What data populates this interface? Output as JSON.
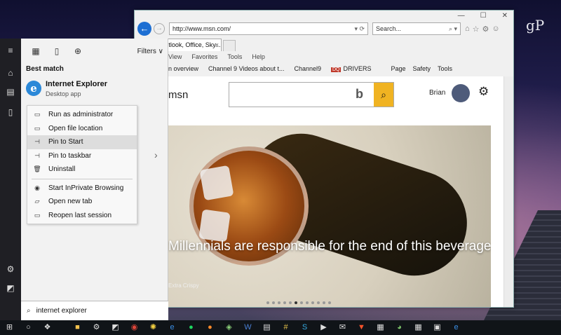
{
  "desktop": {
    "watermark": "gP"
  },
  "start_rail": {
    "icons": [
      "hamburger-icon",
      "home-icon",
      "documents-icon",
      "device-icon",
      "settings-icon",
      "windows-store-icon"
    ]
  },
  "start_panel": {
    "filters_label": "Filters",
    "best_match_heading": "Best match",
    "best_match_title": "Internet Explorer",
    "best_match_subtitle": "Desktop app",
    "context_menu": [
      {
        "label": "Run as administrator",
        "icon": "run-as-admin-icon"
      },
      {
        "label": "Open file location",
        "icon": "open-file-location-icon"
      },
      {
        "label": "Pin to Start",
        "icon": "pin-icon",
        "highlighted": true
      },
      {
        "label": "Pin to taskbar",
        "icon": "pin-icon"
      },
      {
        "label": "Uninstall",
        "icon": "trash-icon"
      },
      {
        "label": "Start InPrivate Browsing",
        "icon": "inprivate-icon",
        "separator_before": true
      },
      {
        "label": "Open new tab",
        "icon": "new-tab-icon"
      },
      {
        "label": "Reopen last session",
        "icon": "reopen-icon"
      }
    ],
    "search_text": "internet explorer"
  },
  "ie_window": {
    "url": "http://www.msn.com/",
    "search_placeholder": "Search...",
    "tab_title": "MSN | Outlook, Office, Sky...",
    "menu": [
      "View",
      "Favorites",
      "Tools",
      "Help"
    ],
    "favorites": [
      "n overview",
      "Channel 9 Videos about t...",
      "Channel9",
      "DRIVERS"
    ],
    "commands": [
      "Page",
      "Safety",
      "Tools"
    ],
    "msn": {
      "logo": "msn",
      "user_name": "Brian",
      "headline": "Millennials are responsible for the end of this beverage",
      "source": "Extra Crispy"
    }
  }
}
